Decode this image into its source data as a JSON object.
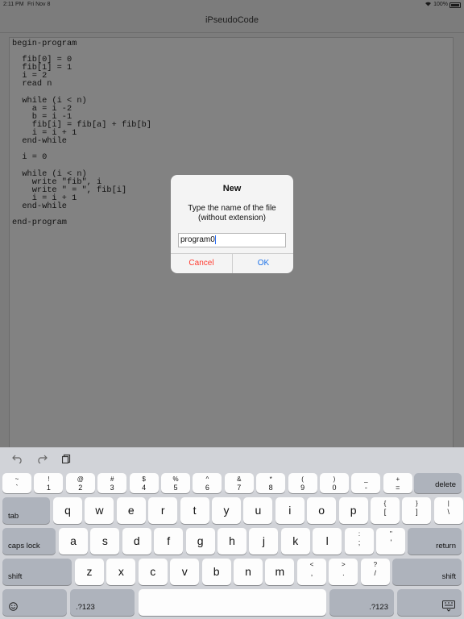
{
  "status_bar": {
    "time": "2:11 PM",
    "date": "Fri Nov 8",
    "battery": "100%"
  },
  "nav": {
    "title": "iPseudoCode"
  },
  "editor": {
    "code": "begin-program\n\n  fib[0] = 0\n  fib[1] = 1\n  i = 2\n  read n\n\n  while (i < n)\n    a = i -2\n    b = i -1\n    fib[i] = fib[a] + fib[b]\n    i = i + 1\n  end-while\n\n  i = 0\n\n  while (i < n)\n    write \"fib\", i\n    write \" = \", fib[i]\n    i = i + 1\n  end-while\n\nend-program"
  },
  "dialog": {
    "title": "New",
    "message": "Type the name of the file (without extension)",
    "input_value": "program0",
    "cancel": "Cancel",
    "ok": "OK"
  },
  "toolbar": {
    "undo_icon": "undo-icon",
    "redo_icon": "redo-icon",
    "paste_icon": "clipboard-icon"
  },
  "keyboard": {
    "row1": [
      {
        "top": "~",
        "bot": "`"
      },
      {
        "top": "!",
        "bot": "1"
      },
      {
        "top": "@",
        "bot": "2"
      },
      {
        "top": "#",
        "bot": "3"
      },
      {
        "top": "$",
        "bot": "4"
      },
      {
        "top": "%",
        "bot": "5"
      },
      {
        "top": "^",
        "bot": "6"
      },
      {
        "top": "&",
        "bot": "7"
      },
      {
        "top": "*",
        "bot": "8"
      },
      {
        "top": "(",
        "bot": "9"
      },
      {
        "top": ")",
        "bot": "0"
      },
      {
        "top": "_",
        "bot": "-"
      },
      {
        "top": "+",
        "bot": "="
      }
    ],
    "row2": [
      "q",
      "w",
      "e",
      "r",
      "t",
      "y",
      "u",
      "i",
      "o",
      "p"
    ],
    "row2_extra": [
      {
        "top": "{",
        "bot": "["
      },
      {
        "top": "}",
        "bot": "]"
      },
      {
        "top": "|",
        "bot": "\\"
      }
    ],
    "row3": [
      "a",
      "s",
      "d",
      "f",
      "g",
      "h",
      "j",
      "k",
      "l"
    ],
    "row3_extra": [
      {
        "top": ":",
        "bot": ";"
      },
      {
        "top": "\"",
        "bot": "'"
      }
    ],
    "row4": [
      "z",
      "x",
      "c",
      "v",
      "b",
      "n",
      "m"
    ],
    "row4_extra": [
      {
        "top": "<",
        "bot": ","
      },
      {
        "top": ">",
        "bot": "."
      },
      {
        "top": "?",
        "bot": "/"
      }
    ],
    "delete": "delete",
    "tab": "tab",
    "caps_lock": "caps lock",
    "return": "return",
    "shift": "shift",
    "numbers": ".?123",
    "emoji_icon": "emoji-icon",
    "dismiss_icon": "keyboard-dismiss-icon"
  }
}
